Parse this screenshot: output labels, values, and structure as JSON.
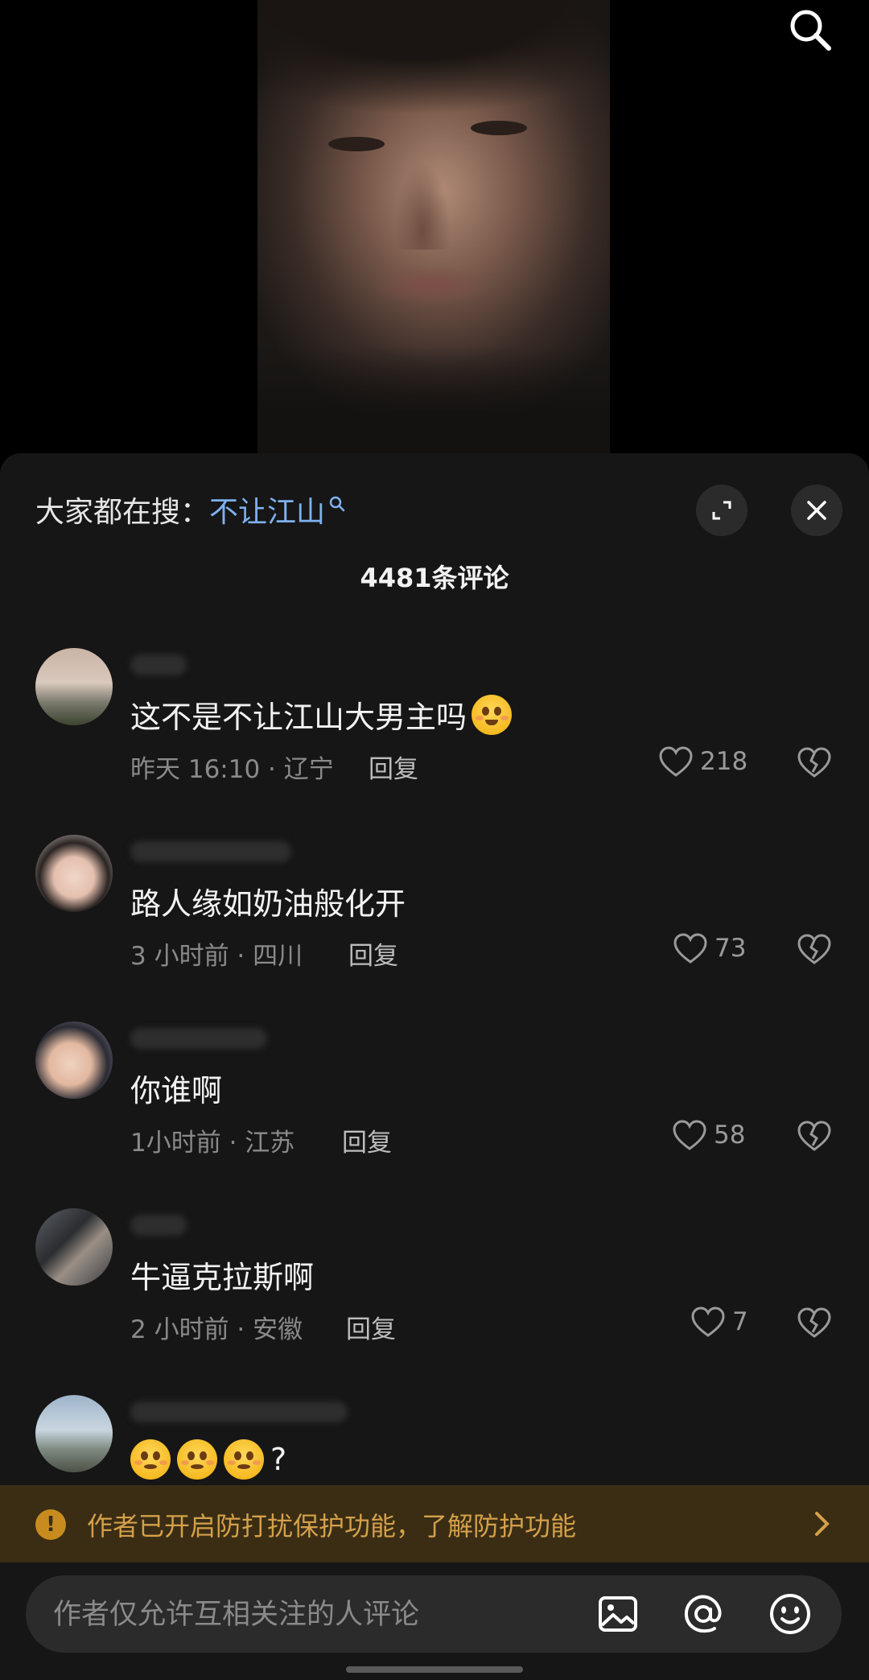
{
  "hot_search": {
    "prefix": "大家都在搜：",
    "keyword": "不让江山"
  },
  "comment_count": "4481条评论",
  "comments": [
    {
      "text": "这不是不让江山大男主吗",
      "meta": "昨天 16:10 · 辽宁",
      "reply": "回复",
      "likes": "218",
      "emoji": "pleading-face-emoji"
    },
    {
      "text": "路人缘如奶油般化开",
      "meta": "3 小时前 · 四川",
      "reply": "回复",
      "likes": "73"
    },
    {
      "text": "你谁啊",
      "meta": "1小时前 · 江苏",
      "reply": "回复",
      "likes": "58"
    },
    {
      "text": "牛逼克拉斯啊",
      "meta": "2 小时前 · 安徽",
      "reply": "回复",
      "likes": "7"
    },
    {
      "text_suffix": "?",
      "emoji": "flushed-face-emoji",
      "emoji_count": 3
    }
  ],
  "protection_banner": {
    "text": "作者已开启防打扰保护功能，了解防护功能"
  },
  "input": {
    "placeholder": "作者仅允许互相关注的人评论"
  },
  "colors": {
    "sheet_bg": "#161616",
    "keyword_blue": "#7fb1f0",
    "banner_bg": "#3a2d14",
    "banner_text": "#d4a04a"
  }
}
